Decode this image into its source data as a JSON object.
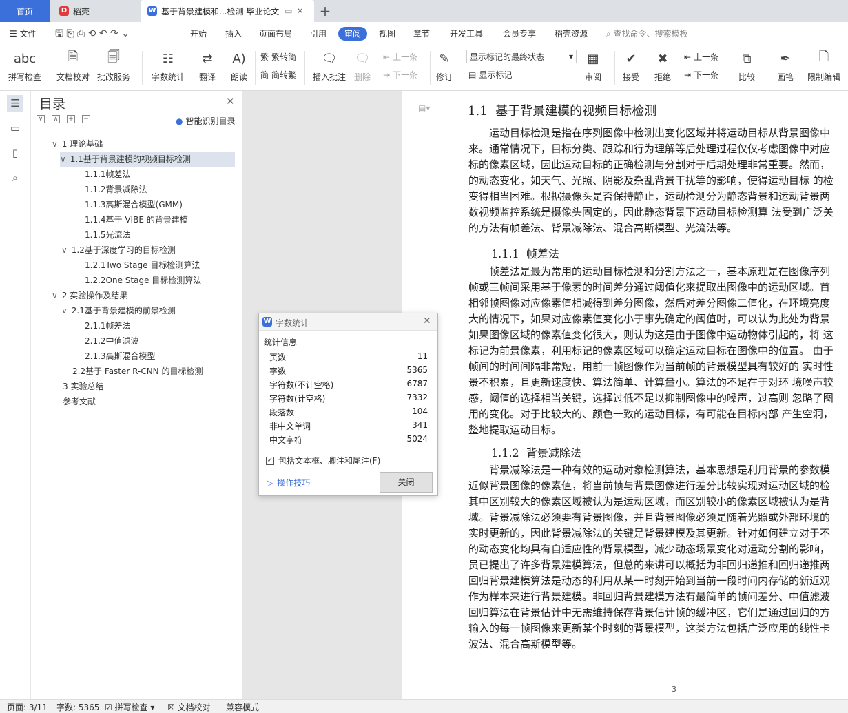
{
  "tabs": {
    "home": "首页",
    "daoke": "稻壳",
    "doc": "基于背景建模和...检测 毕业论文"
  },
  "menu": {
    "file": "文件",
    "items": [
      "开始",
      "插入",
      "页面布局",
      "引用",
      "审阅",
      "视图",
      "章节",
      "开发工具",
      "会员专享",
      "稻壳资源"
    ],
    "search": "查找命令、搜索模板"
  },
  "ribbon": {
    "spell": "拼写检查",
    "proofread": "文档校对",
    "batch": "批改服务",
    "wordcount": "字数统计",
    "translate": "翻译",
    "read": "朗读",
    "trad": "繁转简",
    "simp": "简转繁",
    "insert_comment": "插入批注",
    "delete": "删除",
    "prev_c": "上一条",
    "next_c": "下一条",
    "track": "修订",
    "show_mode": "显示标记的最终状态",
    "show_marks": "显示标记",
    "review": "审阅",
    "accept": "接受",
    "reject": "拒绝",
    "prev": "上一条",
    "next": "下一条",
    "compare": "比较",
    "pen": "画笔",
    "restrict": "限制编辑"
  },
  "toc": {
    "title": "目录",
    "smart": "智能识别目录",
    "items": [
      {
        "label": "1 理论基础",
        "toggle": "∨"
      },
      {
        "label": "1.1基于背景建模的视频目标检测",
        "toggle": "∨"
      },
      {
        "label": "1.1.1帧差法",
        "toggle": ""
      },
      {
        "label": "1.1.2背景减除法",
        "toggle": ""
      },
      {
        "label": "1.1.3高斯混合模型(GMM)",
        "toggle": ""
      },
      {
        "label": "1.1.4基于 VIBE 的背景建模",
        "toggle": ""
      },
      {
        "label": "1.1.5光流法",
        "toggle": ""
      },
      {
        "label": "1.2基于深度学习的目标检测",
        "toggle": "∨"
      },
      {
        "label": "1.2.1Two Stage 目标检测算法",
        "toggle": ""
      },
      {
        "label": "1.2.2One Stage 目标检测算法",
        "toggle": ""
      },
      {
        "label": "2 实验操作及结果",
        "toggle": "∨"
      },
      {
        "label": "2.1基于背景建模的前景检测",
        "toggle": "∨"
      },
      {
        "label": "2.1.1帧差法",
        "toggle": ""
      },
      {
        "label": "2.1.2中值滤波",
        "toggle": ""
      },
      {
        "label": "2.1.3高斯混合模型",
        "toggle": ""
      },
      {
        "label": "2.2基于 Faster R-CNN 的目标检测",
        "toggle": ""
      },
      {
        "label": "3 实验总结",
        "toggle": ""
      },
      {
        "label": "参考文献",
        "toggle": ""
      }
    ]
  },
  "doc": {
    "h1_num": "1.1",
    "h1_text": "基于背景建模的视频目标检测",
    "p1": "　　运动目标检测是指在序列图像中检测出变化区域并将运动目标从背景图像中\n来。通常情况下，目标分类、跟踪和行为理解等后处理过程仅仅考虑图像中对应\n标的像素区域，因此运动目标的正确检测与分割对于后期处理非常重要。然而，\n的动态变化，如天气、光照、阴影及杂乱背景干扰等的影响，使得运动目标 的检\n变得相当困难。根据摄像头是否保持静止，运动检测分为静态背景和运动背景两\n数视频监控系统是摄像头固定的，因此静态背景下运动目标检测算 法受到广泛关\n的方法有帧差法、背景减除法、混合高斯模型、光流法等。",
    "h2a_num": "1.1.1",
    "h2a_text": "帧差法",
    "p2": "　　帧差法是最为常用的运动目标检测和分割方法之一，基本原理是在图像序列\n帧或三帧间采用基于像素的时间差分通过阈值化来提取出图像中的运动区域。首\n相邻帧图像对应像素值相减得到差分图像，然后对差分图像二值化，在环境亮度\n大的情况下，如果对应像素值变化小于事先确定的阈值时，可以认为此处为背景\n如果图像区域的像素值变化很大，则认为这是由于图像中运动物体引起的，将 这\n标记为前景像素，利用标记的像素区域可以确定运动目标在图像中的位置。 由于\n帧间的时间间隔非常短，用前一帧图像作为当前帧的背景模型具有较好的 实时性\n景不积累，且更新速度快、算法简单、计算量小。算法的不足在于对环 境噪声较\n感，阈值的选择相当关键，选择过低不足以抑制图像中的噪声，过高则 忽略了图\n用的变化。对于比较大的、颜色一致的运动目标，有可能在目标内部 产生空洞，\n整地提取运动目标。",
    "h2b_num": "1.1.2",
    "h2b_text": "背景减除法",
    "p3": "　　背景减除法是一种有效的运动对象检测算法，基本思想是利用背景的参数模\n近似背景图像的像素值，将当前帧与背景图像进行差分比较实现对运动区域的检\n其中区别较大的像素区域被认为是运动区域，而区别较小的像素区域被认为是背\n域。背景减除法必须要有背景图像，并且背景图像必须是随着光照或外部环境的\n实时更新的，因此背景减除法的关键是背景建模及其更新。针对如何建立对于不\n的动态变化均具有自适应性的背景模型，减少动态场景变化对运动分割的影响，\n员已提出了许多背景建模算法，但总的来讲可以概括为非回归递推和回归递推两\n回归背景建模算法是动态的利用从某一时刻开始到当前一段时间内存储的新近观\n作为样本来进行背景建模。非回归背景建模方法有最简单的帧间差分、中值滤波\n回归算法在背景估计中无需维持保存背景估计帧的缓冲区，它们是通过回归的方\n输入的每一帧图像来更新某个时刻的背景模型，这类方法包括广泛应用的线性卡\n波法、混合高斯模型等。",
    "page_num": "3"
  },
  "dialog": {
    "title": "字数统计",
    "group": "统计信息",
    "rows": [
      {
        "label": "页数",
        "value": "11"
      },
      {
        "label": "字数",
        "value": "5365"
      },
      {
        "label": "字符数(不计空格)",
        "value": "6787"
      },
      {
        "label": "字符数(计空格)",
        "value": "7332"
      },
      {
        "label": "段落数",
        "value": "104"
      },
      {
        "label": "非中文单词",
        "value": "341"
      },
      {
        "label": "中文字符",
        "value": "5024"
      }
    ],
    "checkbox": "包括文本框、脚注和尾注(F)",
    "tips": "操作技巧",
    "close": "关闭"
  },
  "status": {
    "page": "页面: 3/11",
    "words": "字数: 5365",
    "spell": "拼写检查",
    "proof": "文档校对",
    "compat": "兼容模式"
  },
  "colors": {
    "accent": "#3b6fd9",
    "tab_bg": "#dde1e6",
    "daoke_red": "#e0393e"
  }
}
